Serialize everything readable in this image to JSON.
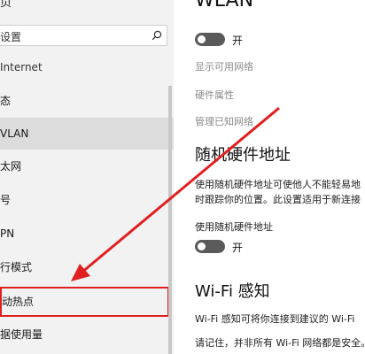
{
  "sidebar": {
    "top_item": "页",
    "search_placeholder": "设置",
    "section_title": "Internet",
    "items": [
      {
        "label": "态",
        "state": "normal"
      },
      {
        "label": "VLAN",
        "state": "selected"
      },
      {
        "label": "太网",
        "state": "normal"
      },
      {
        "label": "号",
        "state": "normal"
      },
      {
        "label": "PN",
        "state": "normal"
      },
      {
        "label": "行模式",
        "state": "normal"
      },
      {
        "label": "动热点",
        "state": "highlighted"
      },
      {
        "label": "据使用量",
        "state": "normal"
      }
    ]
  },
  "content": {
    "title": "WLAN",
    "wlan_toggle": {
      "state_label": "开"
    },
    "links": [
      "显示可用网络",
      "硬件属性",
      "管理已知网络"
    ],
    "random_mac": {
      "heading": "随机硬件地址",
      "desc_line1": "使用随机硬件地址可使他人不能轻易地",
      "desc_line2": "时跟踪你的位置。此设置适用于新连接",
      "setting_label": "使用随机硬件地址",
      "toggle_state_label": "开"
    },
    "wifi_sense": {
      "heading": "Wi-Fi 感知",
      "desc_line1": "Wi-Fi 感知可将你连接到建议的 Wi-Fi",
      "desc_line2": "请记住，并非所有 Wi-Fi 网络都是安全。"
    }
  },
  "colors": {
    "annotation": "#e02020",
    "sidebar_bg": "#f2f2f2",
    "selected_bg": "#dcdcdc",
    "toggle_bg": "#5a5a5a"
  }
}
